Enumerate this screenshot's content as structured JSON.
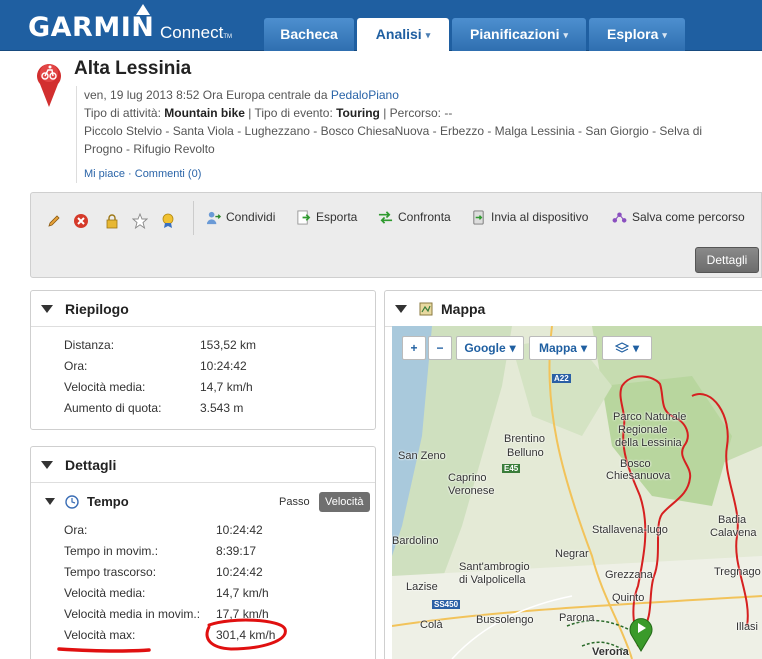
{
  "header": {
    "logo": "GARMIN",
    "product": "Connect",
    "product_tm": "TM",
    "tabs": [
      {
        "label": "Bacheca",
        "active": false,
        "has_menu": false
      },
      {
        "label": "Analisi",
        "active": true,
        "has_menu": true
      },
      {
        "label": "Pianificazioni",
        "active": false,
        "has_menu": true
      },
      {
        "label": "Esplora",
        "active": false,
        "has_menu": true
      }
    ],
    "colors": {
      "bar": "#1f5fa1",
      "tab": "#3d7fc0"
    }
  },
  "activity": {
    "title": "Alta Lessinia",
    "date_line_prefix": "ven, 19 lug 2013 8:52 Ora Europa centrale da ",
    "user": "PedaloPiano",
    "type_label": "Tipo di attività: ",
    "type_value": "Mountain bike",
    "event_label": " | Tipo di evento: ",
    "event_value": "Touring",
    "route_label": " | Percorso: --",
    "description": "Piccolo Stelvio - Santa Viola - Lughezzano - Bosco ChiesaNuova - Erbezzo - Malga Lessinia - San Giorgio - Selva di Progno - Rifugio Revolto",
    "likes": "Mi piace",
    "separator": " · ",
    "comments": "Commenti (0)"
  },
  "toolbar": {
    "icons": [
      "pencil-icon",
      "delete-icon",
      "lock-icon",
      "star-icon",
      "badge-icon"
    ],
    "actions": [
      {
        "label": "Condividi",
        "icon": "share-icon"
      },
      {
        "label": "Esporta",
        "icon": "export-icon"
      },
      {
        "label": "Confronta",
        "icon": "compare-icon"
      },
      {
        "label": "Invia al dispositivo",
        "icon": "send-device-icon"
      },
      {
        "label": "Salva come percorso",
        "icon": "save-route-icon"
      }
    ],
    "details_button": "Dettagli"
  },
  "summary": {
    "title": "Riepilogo",
    "rows": [
      {
        "label": "Distanza:",
        "value": "153,52 km"
      },
      {
        "label": "Ora:",
        "value": "10:24:42"
      },
      {
        "label": "Velocità media:",
        "value": "14,7 km/h"
      },
      {
        "label": "Aumento di quota:",
        "value": "3.543 m"
      }
    ]
  },
  "details": {
    "title": "Dettagli",
    "section": "Tempo",
    "toggle": {
      "pace": "Passo",
      "speed": "Velocità"
    },
    "rows": [
      {
        "label": "Ora:",
        "value": "10:24:42"
      },
      {
        "label": "Tempo in movim.:",
        "value": "8:39:17"
      },
      {
        "label": "Tempo trascorso:",
        "value": "10:24:42"
      },
      {
        "label": "Velocità media:",
        "value": "14,7 km/h"
      },
      {
        "label": "Velocità media in movim.:",
        "value": "17,7 km/h"
      },
      {
        "label": "Velocità max:",
        "value": "301,4 km/h"
      }
    ]
  },
  "map": {
    "title": "Mappa",
    "zoom_in": "+",
    "zoom_out": "−",
    "provider": "Google",
    "map_type": "Mappa",
    "labels": [
      "Brentino",
      "Belluno",
      "San Zeno",
      "Caprino",
      "Veronese",
      "Parco Naturale",
      "Regionale",
      "della Lessinia",
      "Bosco",
      "Chiesanuova",
      "Stallavena-lugo",
      "Badia",
      "Calavena",
      "Bardolino",
      "Negrar",
      "Tregnago",
      "Lazise",
      "Sant'ambrogio",
      "di Valpolicella",
      "Grezzana",
      "Quinto",
      "Parona",
      "Bussolengo",
      "Colà",
      "Illasi",
      "Verona"
    ],
    "roads": [
      "A22",
      "E45",
      "SS450"
    ]
  }
}
